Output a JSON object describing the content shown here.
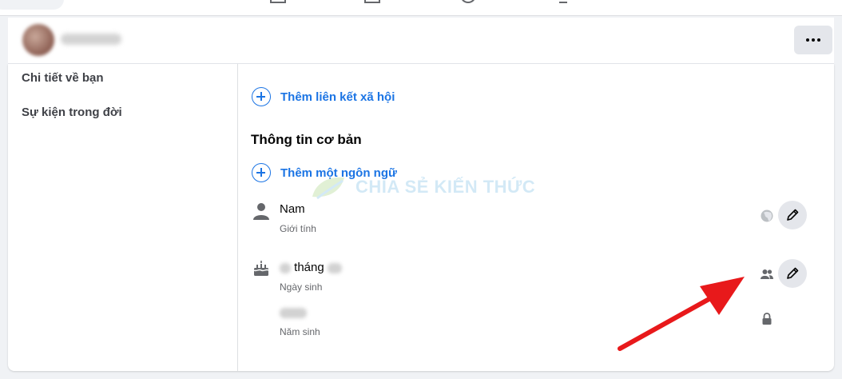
{
  "sidebar": {
    "items": [
      {
        "label": "Chi tiết về bạn"
      },
      {
        "label": "Sự kiện trong đời"
      }
    ]
  },
  "main": {
    "add_social_link": "Thêm liên kết xã hội",
    "section_title": "Thông tin cơ bản",
    "add_language": "Thêm một ngôn ngữ",
    "gender": {
      "value": "Nam",
      "label": "Giới tính",
      "audience_icon": "globe-icon"
    },
    "birthday": {
      "value": "tháng",
      "label": "Ngày sinh",
      "audience_icon": "friends-icon"
    },
    "birth_year": {
      "label": "Năm sinh",
      "audience_icon": "lock-icon"
    }
  },
  "watermark": {
    "text": "CHIA SẺ KIẾN THỨC"
  },
  "colors": {
    "accent": "#1b74e4",
    "annotation_arrow": "#e8191b"
  }
}
